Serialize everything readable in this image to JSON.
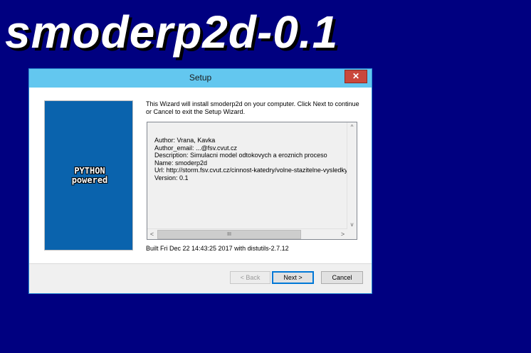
{
  "banner": {
    "text": "smoderp2d-0.1"
  },
  "window": {
    "title": "Setup",
    "close_label": "✕"
  },
  "logo": {
    "line1": "PYTHON",
    "line2": "powered"
  },
  "intro": {
    "text": "This Wizard will install smoderp2d on your computer. Click Next to continue or Cancel to exit the Setup Wizard."
  },
  "info": {
    "lines": [
      "Author: Vrana, Kavka",
      "Author_email: ...@fsv.cvut.cz",
      "Description: Simulacni model odtokovych a eroznich proceso",
      "Name: smoderp2d",
      "Url: http://storm.fsv.cvut.cz/cinnost-katedry/volne-stazitelne-vysledky/s",
      "Version: 0.1"
    ]
  },
  "scroll": {
    "up": "^",
    "down": "v",
    "left": "<",
    "right": ">",
    "thumb": "III"
  },
  "built": {
    "text": "Built Fri Dec 22 14:43:25 2017 with distutils-2.7.12"
  },
  "buttons": {
    "back": "< Back",
    "next": "Next >",
    "cancel": "Cancel"
  }
}
